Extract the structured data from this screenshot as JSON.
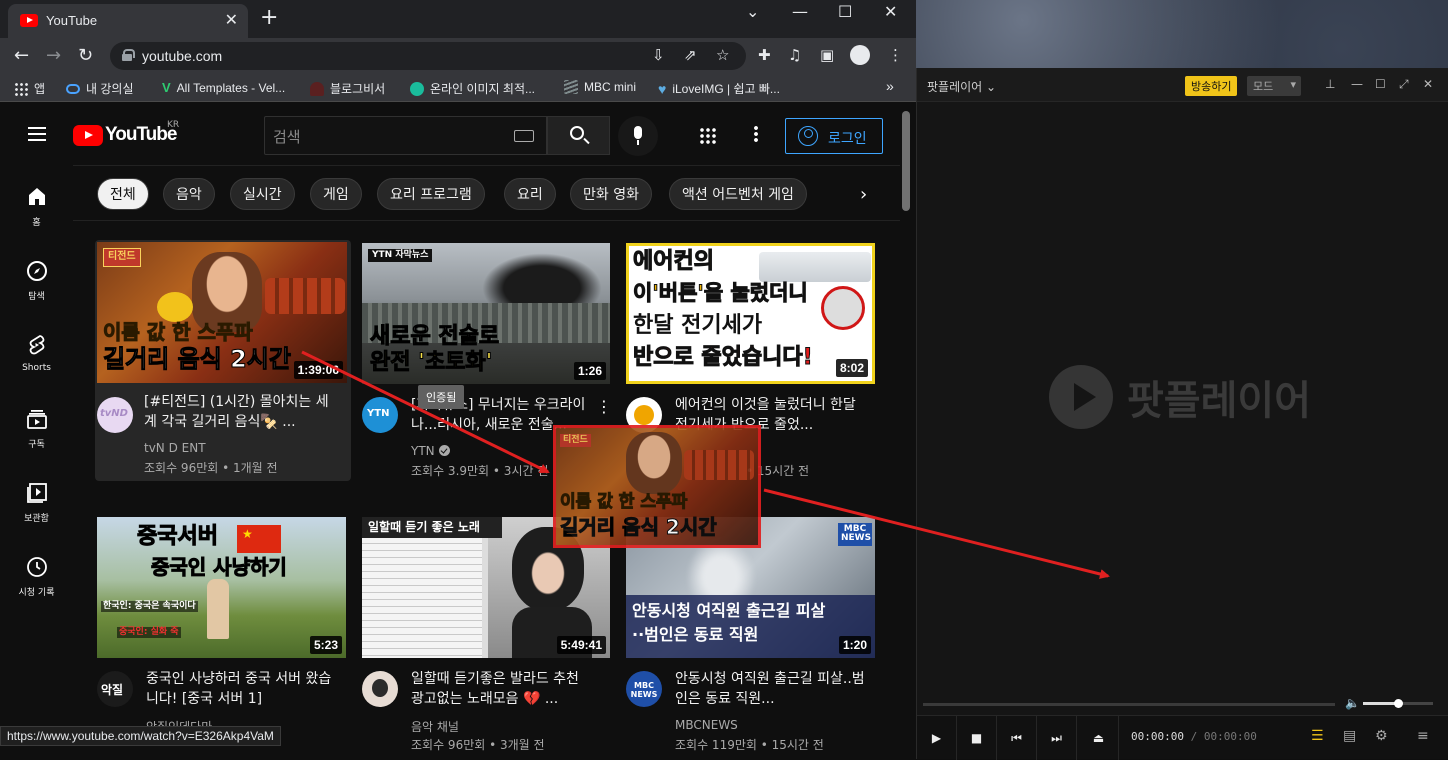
{
  "browser": {
    "tab_title": "YouTube",
    "url": "youtube.com",
    "status_url": "https://www.youtube.com/watch?v=E326Akp4VaM",
    "bookmarks": [
      {
        "label": "앱",
        "color": "#e8eaed"
      },
      {
        "label": "내 강의실",
        "color": "#4aa3ff"
      },
      {
        "label": "All Templates - Vel...",
        "color": "#2ecc71"
      },
      {
        "label": "블로그비서",
        "color": "#c0392b"
      },
      {
        "label": "온라인 이미지 최적...",
        "color": "#1abc9c"
      },
      {
        "label": "MBC mini",
        "color": "#7f8c8d"
      },
      {
        "label": "iLoveIMG | 쉽고 빠...",
        "color": "#5dade2"
      }
    ],
    "bookmarks_more": "»"
  },
  "youtube": {
    "logo_text": "YouTube",
    "region": "KR",
    "search_placeholder": "검색",
    "login_label": "로그인",
    "chips": [
      "전체",
      "음악",
      "실시간",
      "게임",
      "요리 프로그램",
      "요리",
      "만화 영화",
      "액션 어드벤처 게임"
    ],
    "active_chip": "전체",
    "guide": [
      {
        "label": "홈",
        "icon": "home-icon"
      },
      {
        "label": "탐색",
        "icon": "compass-icon"
      },
      {
        "label": "Shorts",
        "icon": "shorts-icon"
      },
      {
        "label": "구독",
        "icon": "subscriptions-icon"
      },
      {
        "label": "보관함",
        "icon": "library-icon"
      },
      {
        "label": "시청 기록",
        "icon": "history-icon"
      }
    ],
    "tooltip": "인증됨",
    "videos": [
      {
        "thumb_lines": [
          "이름 값 한 스푸파",
          "길거리 음식 2시간"
        ],
        "thumb_badge": "티전드",
        "duration": "1:39:06",
        "title": "[#티전드] (1시간) 몰아치는 세계 각국 길거리 음식🍢 ...",
        "channel": "tvN D ENT",
        "meta": "조회수 96만회 • 1개월 전",
        "avatar_text": "tvND"
      },
      {
        "thumb_lines": [
          "새로운 전술로",
          "완전 '초토화'"
        ],
        "thumb_badge": "YTN 자막뉴스",
        "duration": "1:26",
        "title": "[자막뉴스] 무너지는 우크라이나...러시아, 새로운 전술...",
        "channel": "YTN",
        "meta": "조회수 3.9만회 • 3시간 전",
        "avatar_text": "YTN"
      },
      {
        "thumb_lines": [
          "에어컨의",
          "이'버튼'을 눌렀더니",
          "한달 전기세가",
          "반으로 줄었습니다!"
        ],
        "duration": "8:02",
        "title": "에어컨의 이것을 눌렀더니 한달 전기세가 반으로 줄었...",
        "channel": "",
        "meta": "• 15시간 전",
        "avatar_text": ""
      },
      {
        "thumb_lines": [
          "중국서버",
          "중국인 사냥하기",
          "한국인: 중국은 속국이다",
          "중국인: 실화 죽"
        ],
        "duration": "5:23",
        "title": "중국인 사냥하러 중국 서버 왔습니다! [중국 서버 1]",
        "channel": "악질인데다마",
        "meta": "",
        "avatar_text": "악질"
      },
      {
        "thumb_lines": [
          "일할때 듣기 좋은 노래"
        ],
        "duration": "5:49:41",
        "title": "일할때 듣기좋은 발라드 추천 광고없는 노래모음 💔 ...",
        "channel": "음악 채널",
        "meta": "조회수 96만회 • 3개월 전",
        "avatar_text": ""
      },
      {
        "thumb_lines": [
          "안동시청 여직원 출근길 피살",
          "··범인은 동료 직원"
        ],
        "thumb_badge": "MBC NEWS",
        "duration": "1:20",
        "title": "안동시청 여직원 출근길 피살..범인은 동료 직원...",
        "channel": "MBCNEWS",
        "meta": "조회수 119만회 • 15시간 전",
        "avatar_text": "MBC NEWS"
      }
    ]
  },
  "drag_ghost": {
    "lines": [
      "이름 값 한 스푸파",
      "길거리 음식 2시간"
    ],
    "badge": "티전드"
  },
  "potplayer": {
    "name": "팟플레이어",
    "broadcast_label": "방송하기",
    "mode_label": "모드",
    "logo_text": "팟플레이어",
    "time_current": "00:00:00",
    "time_sep": "/",
    "time_total": "00:00:00",
    "volume_level": 0.5
  },
  "colors": {
    "accent_red": "#e02020",
    "yt_red": "#ff0000",
    "link_blue": "#3ea6ff",
    "broadcast_yellow": "#f0c419"
  }
}
